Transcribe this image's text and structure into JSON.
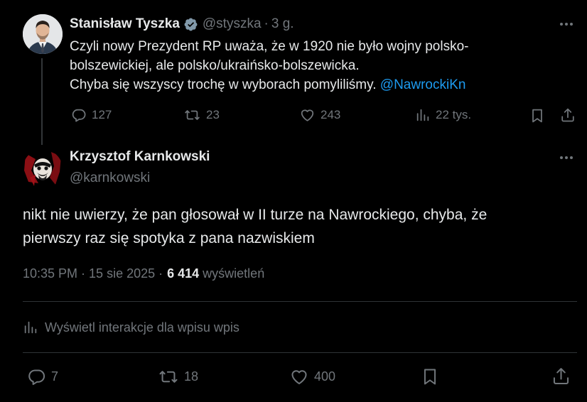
{
  "parent_tweet": {
    "author_name": "Stanisław Tyszka",
    "handle": "@styszka",
    "separator": "·",
    "time": "3 g.",
    "text_lines": [
      "Czyli nowy Prezydent RP uważa, że w 1920 nie było wojny polsko-",
      "bolszewickiej, ale polsko/ukraińsko-bolszewicka.",
      "Chyba się wszyscy trochę w wyborach pomyliliśmy."
    ],
    "mention": "@NawrockiKn",
    "stats": {
      "replies": "127",
      "reposts": "23",
      "likes": "243",
      "views": "22 tys."
    },
    "icons": [
      "verified-badge-icon",
      "more-icon",
      "reply-icon",
      "repost-icon",
      "like-icon",
      "views-icon",
      "bookmark-icon",
      "share-icon"
    ]
  },
  "reply_tweet": {
    "author_name": "Krzysztof Karnkowski",
    "handle": "@karnkowski",
    "text_lines": [
      "nikt nie uwierzy, że pan głosował w II turze na Nawrockiego, chyba, że",
      "pierwszy raz się spotyka z pana nazwiskiem"
    ],
    "timestamp": "10:35 PM · 15 sie 2025 ·",
    "views_count": "6 414",
    "views_label": "wyświetleń",
    "interactions_link": "Wyświetl interakcje dla wpisu wpis",
    "stats": {
      "replies": "7",
      "reposts": "18",
      "likes": "400"
    }
  },
  "colors": {
    "background": "#000000",
    "text_primary": "#e7e9ea",
    "text_secondary": "#71767b",
    "link": "#1d9bf0",
    "divider": "#2f3336",
    "verified": "#829aab"
  }
}
